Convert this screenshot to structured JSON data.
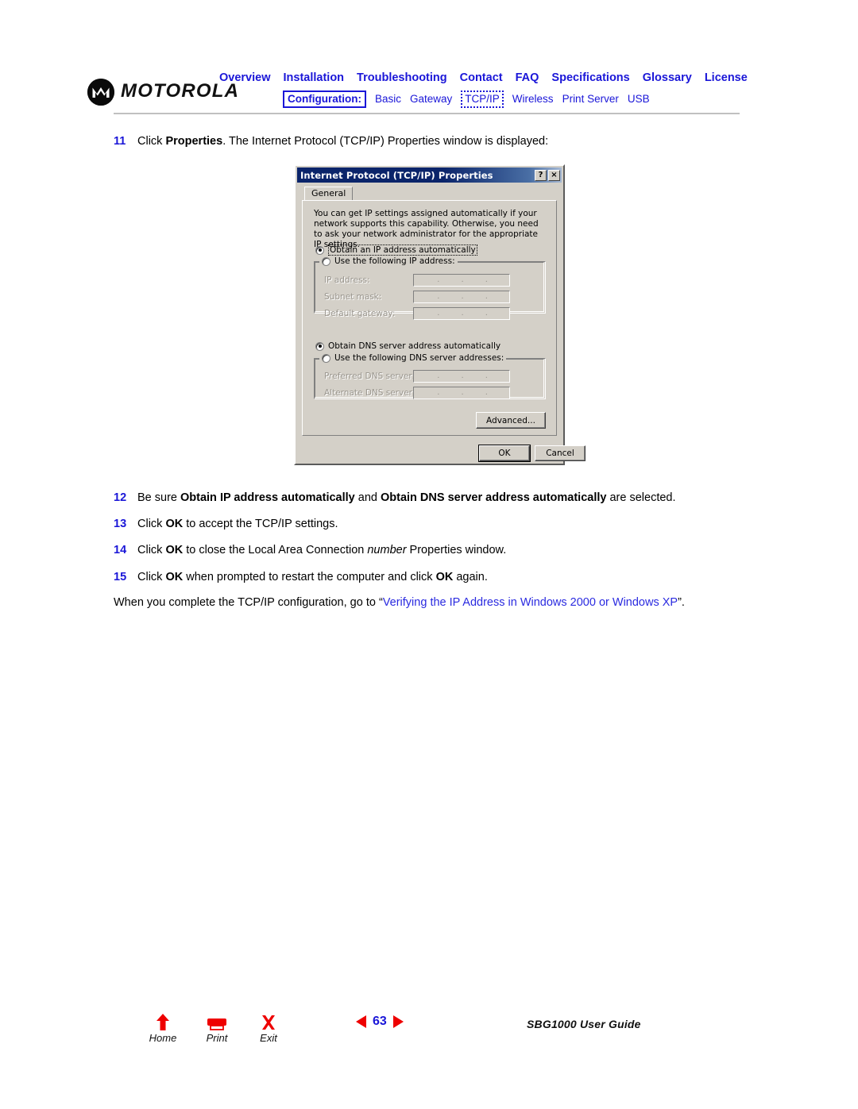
{
  "brand": {
    "logo_text": "MOTOROLA",
    "logo_icon": "motorola-m-batwing-logo"
  },
  "nav": {
    "primary": [
      "Overview",
      "Installation",
      "Troubleshooting",
      "Contact",
      "FAQ",
      "Specifications",
      "Glossary",
      "License"
    ],
    "section_label": "Configuration:",
    "secondary": [
      "Basic",
      "Gateway",
      "TCP/IP",
      "Wireless",
      "Print Server",
      "USB"
    ],
    "active_secondary": "TCP/IP",
    "link_color": "#1a16d8"
  },
  "steps": [
    {
      "number": "11",
      "parts": [
        {
          "t": "Click ",
          "s": "n"
        },
        {
          "t": "Properties",
          "s": "b"
        },
        {
          "t": ". The Internet Protocol (TCP/IP) Properties window is displayed:",
          "s": "n"
        }
      ]
    },
    {
      "number": "12",
      "parts": [
        {
          "t": "Be sure ",
          "s": "n"
        },
        {
          "t": "Obtain IP address automatically",
          "s": "b"
        },
        {
          "t": " and ",
          "s": "n"
        },
        {
          "t": "Obtain DNS server address automatically",
          "s": "b"
        },
        {
          "t": " are selected.",
          "s": "n"
        }
      ]
    },
    {
      "number": "13",
      "parts": [
        {
          "t": "Click ",
          "s": "n"
        },
        {
          "t": "OK",
          "s": "b"
        },
        {
          "t": " to accept the TCP/IP settings.",
          "s": "n"
        }
      ]
    },
    {
      "number": "14",
      "parts": [
        {
          "t": "Click ",
          "s": "n"
        },
        {
          "t": "OK",
          "s": "b"
        },
        {
          "t": " to close the Local Area Connection ",
          "s": "n"
        },
        {
          "t": "number",
          "s": "i"
        },
        {
          "t": " Properties window.",
          "s": "n"
        }
      ]
    },
    {
      "number": "15",
      "parts": [
        {
          "t": "Click ",
          "s": "n"
        },
        {
          "t": "OK",
          "s": "b"
        },
        {
          "t": " when prompted to restart the computer and click ",
          "s": "n"
        },
        {
          "t": "OK",
          "s": "b"
        },
        {
          "t": " again.",
          "s": "n"
        }
      ]
    }
  ],
  "closing_paragraph": {
    "before": "When you complete the TCP/IP configuration, go to “",
    "link": "Verifying the IP Address in Windows 2000 or Windows XP",
    "after": "”."
  },
  "dialog": {
    "title": "Internet Protocol (TCP/IP) Properties",
    "help_button": "?",
    "close_button": "×",
    "tab": "General",
    "description": "You can get IP settings assigned automatically if your network supports this capability. Otherwise, you need to ask your network administrator for the appropriate IP settings.",
    "ip_auto_radio": "Obtain an IP address automatically",
    "ip_auto_selected": true,
    "ip_manual_radio": "Use the following IP address:",
    "ip_manual_selected": false,
    "ip_fields": [
      {
        "label": "IP address:",
        "value": ""
      },
      {
        "label": "Subnet mask:",
        "value": ""
      },
      {
        "label": "Default gateway:",
        "value": ""
      }
    ],
    "dns_auto_radio": "Obtain DNS server address automatically",
    "dns_auto_selected": true,
    "dns_manual_radio": "Use the following DNS server addresses:",
    "dns_manual_selected": false,
    "dns_fields": [
      {
        "label": "Preferred DNS server:",
        "value": ""
      },
      {
        "label": "Alternate DNS server:",
        "value": ""
      }
    ],
    "advanced_button": "Advanced...",
    "ok_button": "OK",
    "cancel_button": "Cancel"
  },
  "footer": {
    "home_label": "Home",
    "print_label": "Print",
    "exit_label": "Exit",
    "page_number": "63",
    "prev_arrow": "left-triangle",
    "next_arrow": "right-triangle",
    "guide_title": "SBG1000 User Guide",
    "accent_red": "#ee0000",
    "accent_blue": "#1a16d8"
  }
}
